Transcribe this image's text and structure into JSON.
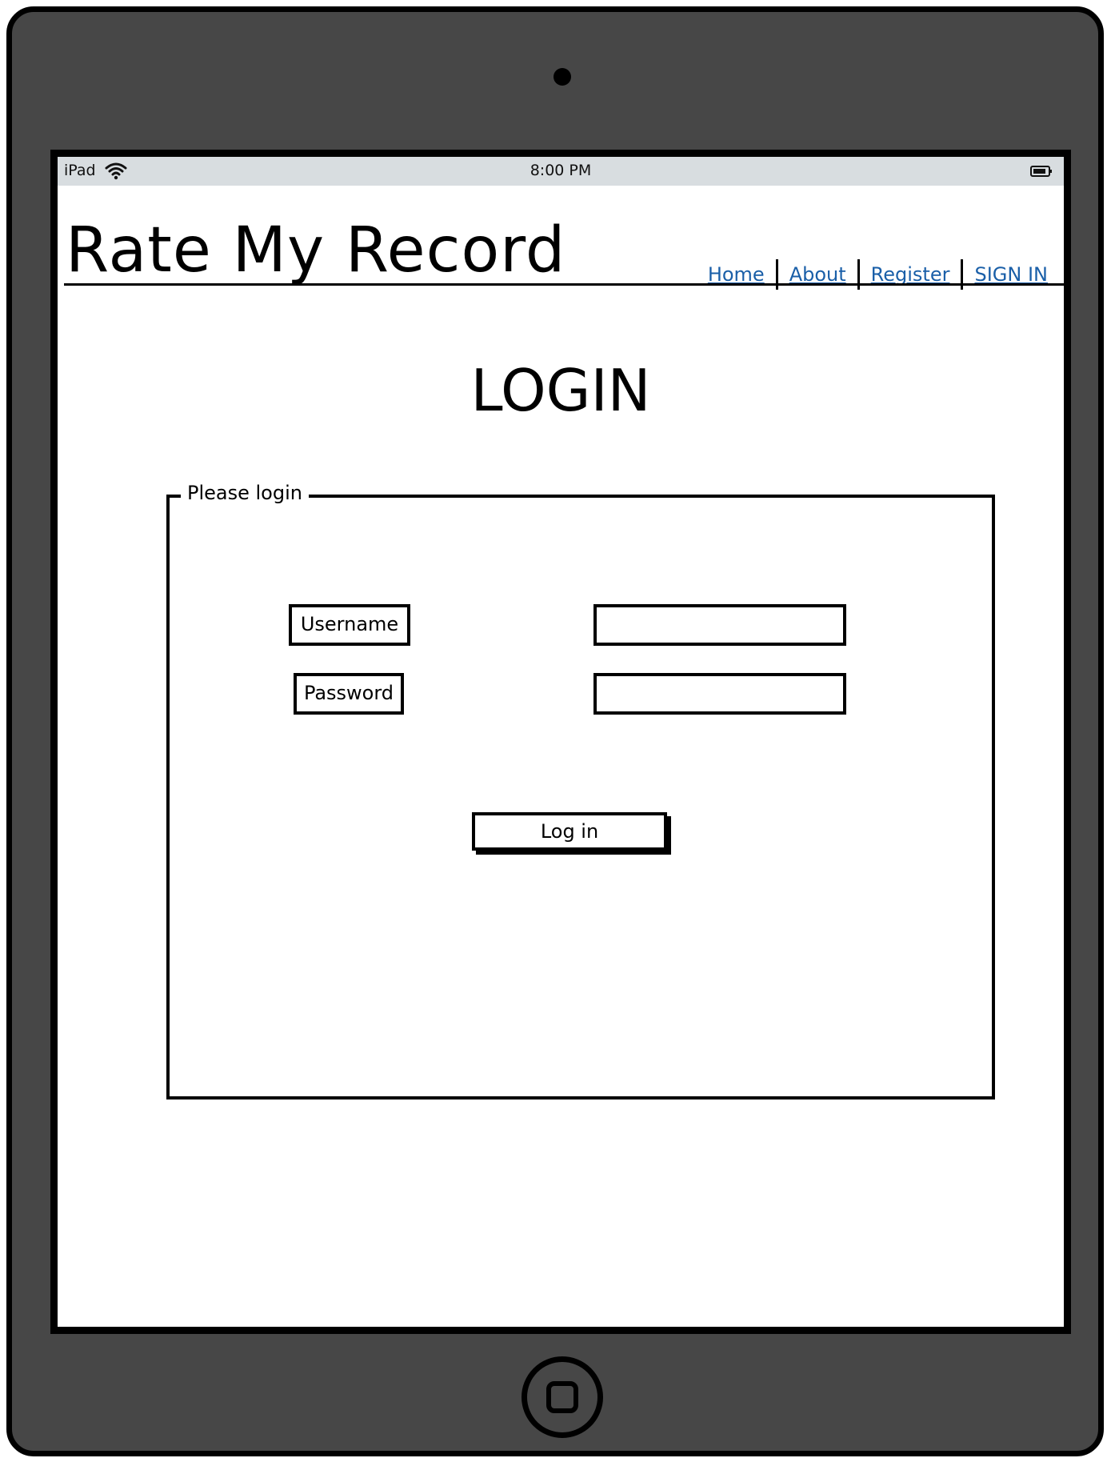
{
  "status_bar": {
    "device": "iPad",
    "time": "8:00 PM",
    "wifi_icon": "wifi-icon",
    "battery_icon": "battery-icon"
  },
  "header": {
    "site_title": "Rate My Record",
    "nav": [
      {
        "label": "Home"
      },
      {
        "label": "About"
      },
      {
        "label": "Register"
      },
      {
        "label": "SIGN IN"
      }
    ]
  },
  "main": {
    "page_title": "LOGIN",
    "login_group": {
      "legend": "Please login",
      "username_label": "Username",
      "username_value": "",
      "password_label": "Password",
      "password_value": "",
      "submit_label": "Log in"
    }
  },
  "colors": {
    "device_frame": "#474747",
    "status_bar": "#d8dde0",
    "link": "#1a5fa8"
  }
}
